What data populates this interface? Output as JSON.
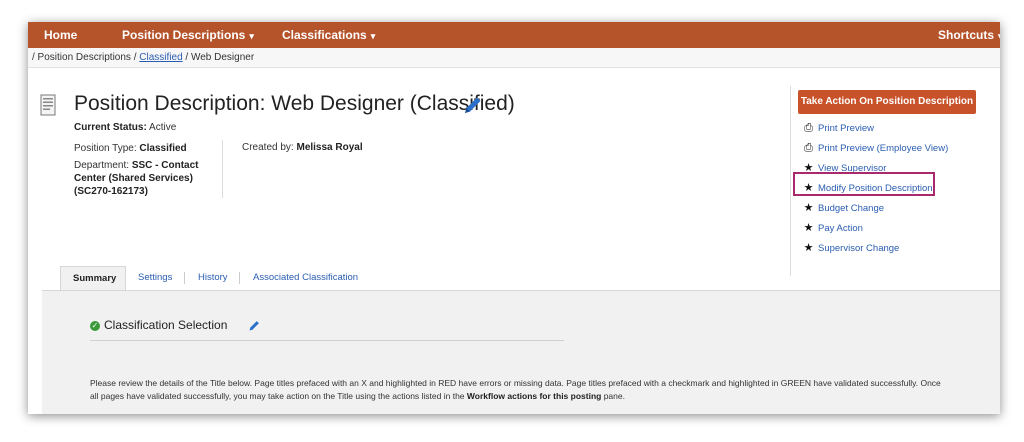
{
  "nav": {
    "home": "Home",
    "position_descriptions": "Position Descriptions",
    "classifications": "Classifications",
    "shortcuts": "Shortcuts"
  },
  "breadcrumb": {
    "part1": "/ Position Descriptions",
    "sep1": "/",
    "link": "Classified",
    "sep2": "/",
    "current": "Web Designer"
  },
  "header": {
    "title": "Position Description: Web Designer (Classified)",
    "status_label": "Current Status:",
    "status_value": "Active",
    "position_type_label": "Position Type:",
    "position_type_value": "Classified",
    "department_label": "Department:",
    "department_value": "SSC - Contact Center (Shared Services) (SC270-162173)",
    "created_by_label": "Created by:",
    "created_by_value": "Melissa Royal"
  },
  "actions": {
    "button_label": "Take Action On Position Description",
    "items": [
      {
        "icon": "printer-icon",
        "label": "Print Preview"
      },
      {
        "icon": "printer-icon",
        "label": "Print Preview (Employee View)"
      },
      {
        "icon": "star-icon",
        "label": "View Supervisor"
      },
      {
        "icon": "star-icon",
        "label": "Modify Position Description"
      },
      {
        "icon": "star-icon",
        "label": "Budget Change"
      },
      {
        "icon": "star-icon",
        "label": "Pay Action"
      },
      {
        "icon": "star-icon",
        "label": "Supervisor Change"
      }
    ]
  },
  "tabs": [
    "Summary",
    "Settings",
    "History",
    "Associated Classification"
  ],
  "active_tab": "Summary",
  "section": {
    "title": "Classification Selection"
  },
  "instructions": {
    "text1": "Please review the details of the Title below.  Page titles prefaced with an X and highlighted in RED have errors or missing data.  Page titles prefaced with a checkmark and highlighted in GREEN have validated successfully.  Once all pages have validated successfully, you may take action on the Title using the actions listed in the ",
    "bold": "Workflow actions for this posting",
    "text2": " pane."
  },
  "colors": {
    "navbar": "#b5532a",
    "action_button": "#c8522a",
    "link": "#2a5db0",
    "highlight": "#a8296d",
    "success": "#3a9a3a"
  }
}
